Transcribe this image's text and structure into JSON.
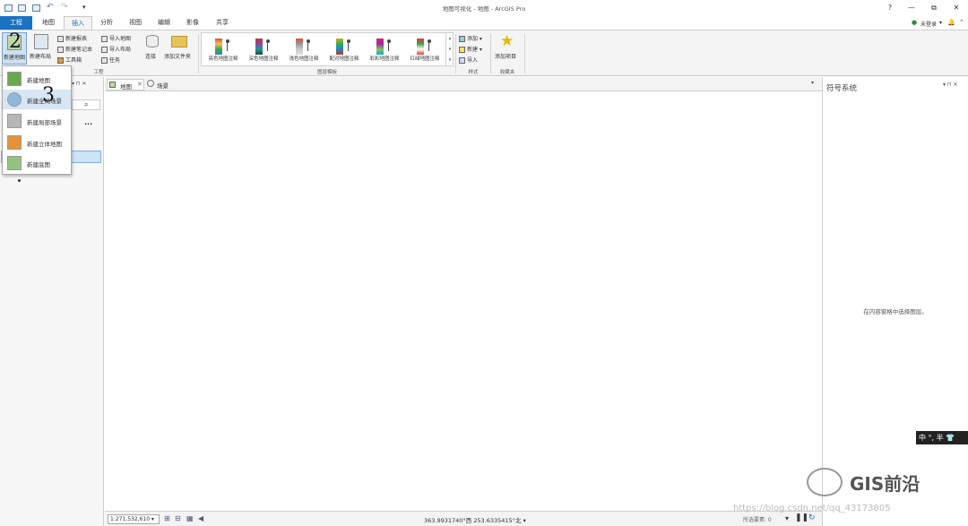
{
  "app": {
    "title": "地图可视化 - 地图 - ArcGIS Pro",
    "window_buttons": [
      "?",
      "—",
      "⧉",
      "✕"
    ],
    "user_label": "未登录",
    "user_dropdown": "▾"
  },
  "tabs": [
    {
      "label": "工程"
    },
    {
      "label": "地图"
    },
    {
      "label": "插入"
    },
    {
      "label": "分析"
    },
    {
      "label": "视图"
    },
    {
      "label": "编辑"
    },
    {
      "label": "影像"
    },
    {
      "label": "共享"
    }
  ],
  "ribbon": {
    "new_map_label": "新建地图",
    "new_layout_label": "新建布局",
    "new_report": "新建报表",
    "new_notebook": "新建笔记本",
    "toolbox": "工具箱",
    "import_map": "导入地图",
    "import_layout": "导入布局",
    "task": "任务",
    "connect": "连接",
    "add_folder": "添加文件夹",
    "project_group": "工程",
    "layer_templates_group": "图层模板",
    "styles": [
      {
        "label": "亮色地图注释",
        "colors": [
          "#e84c3d",
          "#f2c14e",
          "#3fa34d",
          "#2e86c1"
        ]
      },
      {
        "label": "深色地图注释",
        "colors": [
          "#c0392b",
          "#8e44ad",
          "#16a085",
          "#2c3e50"
        ]
      },
      {
        "label": "浅色地图注释",
        "colors": [
          "#e74c3c",
          "#999999",
          "#cccccc",
          "#dddddd"
        ]
      },
      {
        "label": "配对地图注释",
        "colors": [
          "#d4ac0d",
          "#27ae60",
          "#2980b9",
          "#c0392b"
        ]
      },
      {
        "label": "彩彩地图注释",
        "colors": [
          "#e91e63",
          "#9c27b0",
          "#8bc34a",
          "#03a9f4"
        ]
      },
      {
        "label": "红绿地图注释",
        "colors": [
          "#e53935",
          "#43a047",
          "#ffffff",
          "#e53935"
        ]
      }
    ],
    "add": "添加",
    "new": "新建",
    "import": "导入",
    "styles_group": "样式",
    "add_favorite": "添加项目",
    "favorites_group": "收藏夹"
  },
  "dropdown": {
    "items": [
      {
        "label": "新建地图",
        "color": "#6aa84f"
      },
      {
        "label": "新建全局场景",
        "color": "#8fb8de"
      },
      {
        "label": "新建局部场景",
        "color": "#b7b7b7"
      },
      {
        "label": "新建立体地图",
        "color": "#e69138"
      },
      {
        "label": "新建底图",
        "color": "#93c47d"
      }
    ],
    "handwritten_2": "2",
    "handwritten_3": "3"
  },
  "left_pane": {
    "search_glyph": "⌕",
    "more": "..."
  },
  "view_tabs": [
    {
      "label": "地图"
    },
    {
      "label": "场景"
    }
  ],
  "right_pane": {
    "title": "符号系统",
    "hint": "在内容窗格中选择图层。"
  },
  "status": {
    "scale": "1:271,532,610",
    "coords": "363.9931740°西 253.6335415°北",
    "selected": "所选要素: 0"
  },
  "ime": {
    "label": "中 °, 半 👕"
  },
  "watermark": {
    "text": "GIS前沿",
    "url": "https://blog.csdn.net/qq_43173805"
  }
}
